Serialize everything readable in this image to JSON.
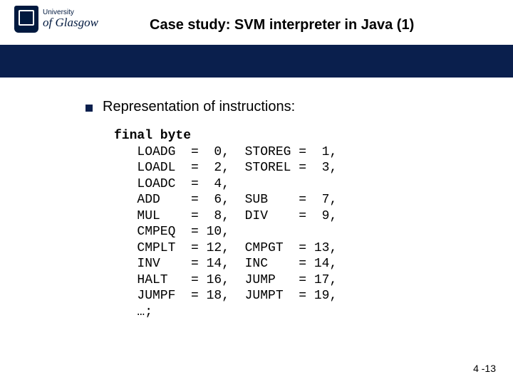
{
  "logo": {
    "line1": "University",
    "line2": "of Glasgow"
  },
  "title": "Case study: SVM interpreter in Java (1)",
  "bullet": "Representation of instructions:",
  "code": {
    "decl": "final byte",
    "rows": [
      {
        "a": "LOADG",
        "av": " 0,",
        "b": "STOREG",
        "bv": " 1,"
      },
      {
        "a": "LOADL",
        "av": " 2,",
        "b": "STOREL",
        "bv": " 3,"
      },
      {
        "a": "LOADC",
        "av": " 4,",
        "b": "",
        "bv": ""
      },
      {
        "a": "ADD",
        "av": " 6,",
        "b": "SUB",
        "bv": " 7,"
      },
      {
        "a": "MUL",
        "av": " 8,",
        "b": "DIV",
        "bv": " 9,"
      },
      {
        "a": "CMPEQ",
        "av": "10,",
        "b": "",
        "bv": ""
      },
      {
        "a": "CMPLT",
        "av": "12,",
        "b": "CMPGT",
        "bv": "13,"
      },
      {
        "a": "INV",
        "av": "14,",
        "b": "INC",
        "bv": "14,"
      },
      {
        "a": "HALT",
        "av": "16,",
        "b": "JUMP",
        "bv": "17,"
      },
      {
        "a": "JUMPF",
        "av": "18,",
        "b": "JUMPT",
        "bv": "19,"
      }
    ],
    "tail": "…;"
  },
  "page": "4 -13"
}
